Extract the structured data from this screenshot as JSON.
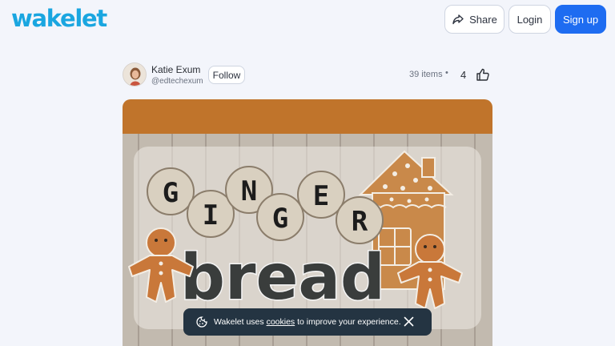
{
  "header": {
    "logo_text": "wakelet",
    "share_label": "Share",
    "login_label": "Login",
    "signup_label": "Sign up"
  },
  "profile": {
    "name": "Katie Exum",
    "handle": "@edtechexum",
    "follow_label": "Follow"
  },
  "collection": {
    "items_count": "39 items",
    "separator": "•",
    "likes": "4",
    "cover_title_top": "GINGER",
    "cover_title_bottom": "bread"
  },
  "cookie_banner": {
    "text_before": "Wakelet uses ",
    "link_text": "cookies",
    "text_after": " to improve your experience."
  },
  "colors": {
    "brand": "#1aa6e0",
    "primary_button": "#1e6cf1",
    "card_header": "#c0742b",
    "cookie_bg": "#243442"
  }
}
